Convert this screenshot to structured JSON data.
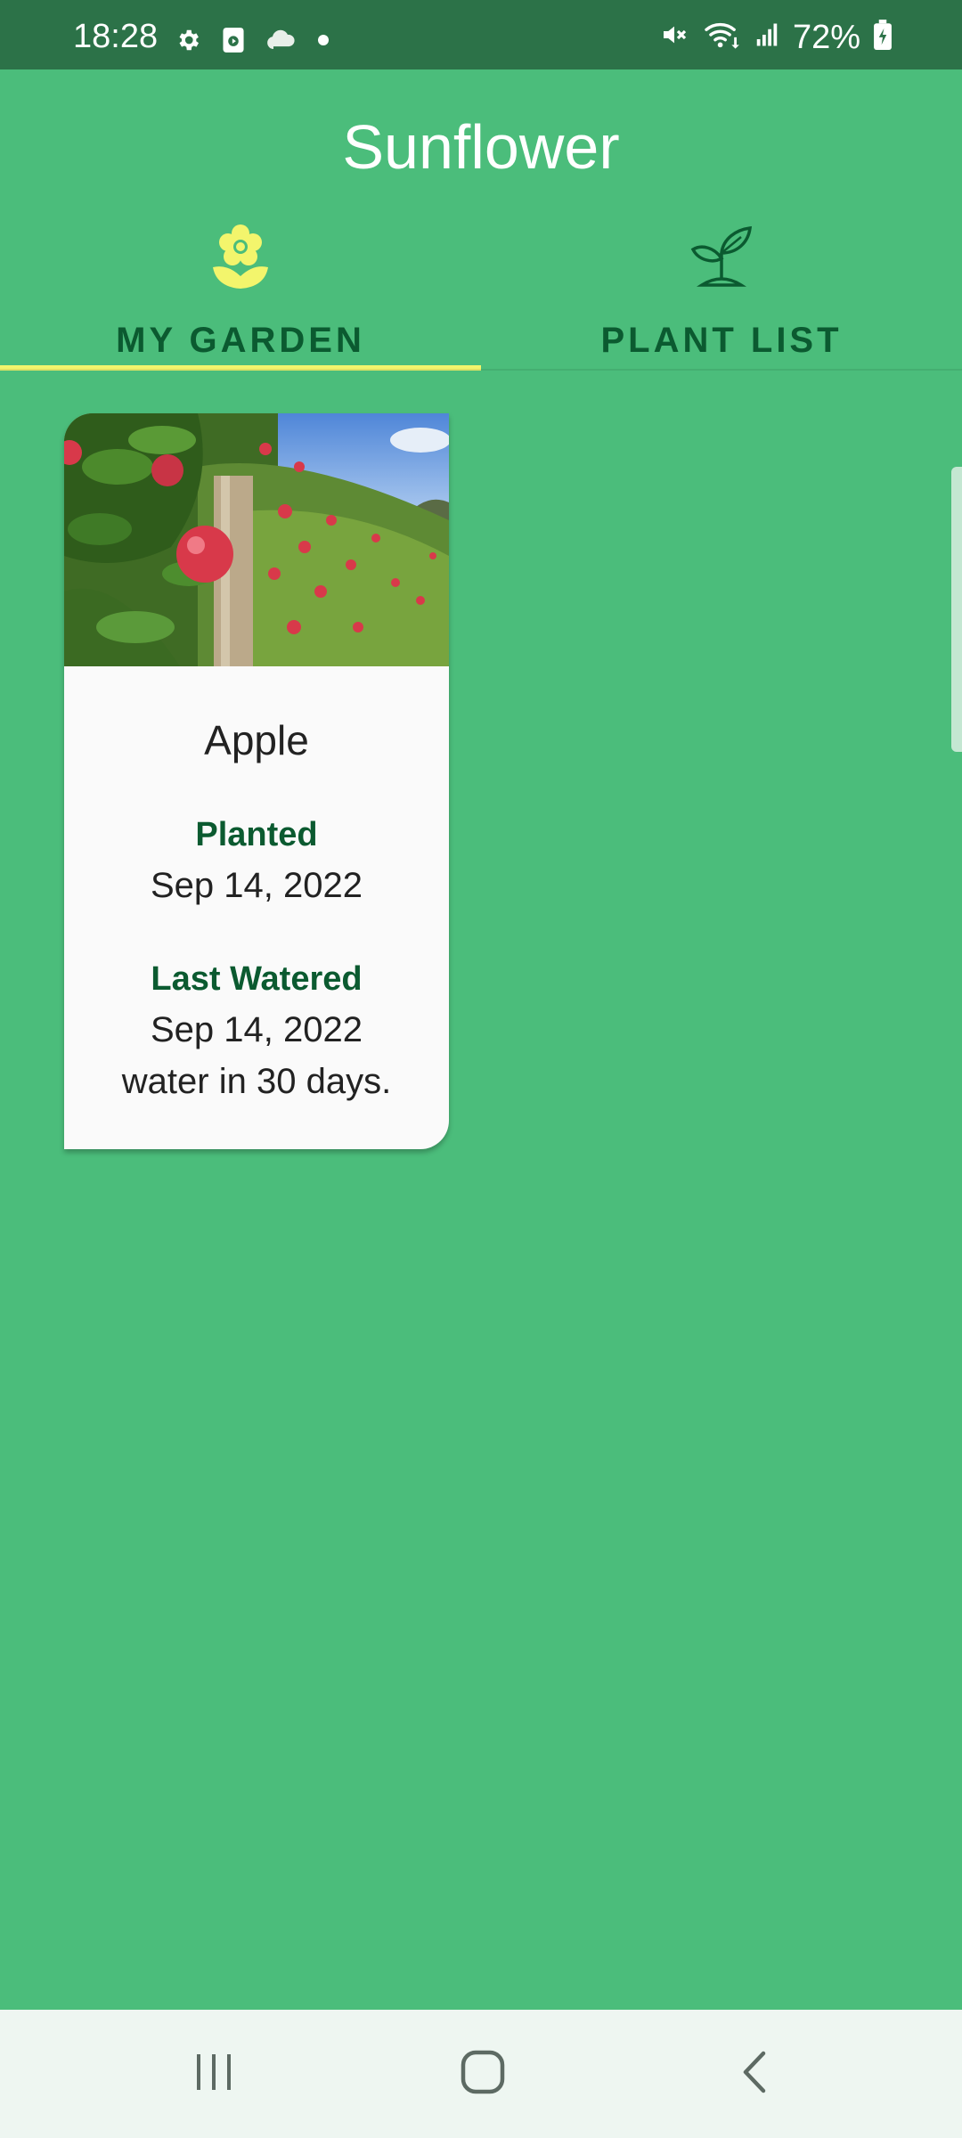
{
  "status_bar": {
    "time": "18:28",
    "battery": "72%",
    "icons": [
      "settings-icon",
      "media-icon",
      "cloud-icon",
      "dot-icon",
      "mute-icon",
      "wifi-icon",
      "signal-icon",
      "battery-icon"
    ]
  },
  "app": {
    "title": "Sunflower"
  },
  "tabs": [
    {
      "label": "MY GARDEN",
      "icon": "flower-icon",
      "selected": true
    },
    {
      "label": "PLANT LIST",
      "icon": "sprout-icon",
      "selected": false
    }
  ],
  "garden": {
    "plants": [
      {
        "name": "Apple",
        "planted_label": "Planted",
        "planted_date": "Sep 14, 2022",
        "watered_label": "Last Watered",
        "watered_date": "Sep 14, 2022",
        "water_note": "water in 30 days."
      }
    ]
  },
  "nav_bar": {
    "buttons": [
      "recent-apps-icon",
      "home-icon",
      "back-icon"
    ]
  },
  "colors": {
    "background": "#4bbd7b",
    "status_bar": "#2c7248",
    "accent_dark": "#0b5a30",
    "indicator": "#f3f56c",
    "card": "#fafafa"
  }
}
